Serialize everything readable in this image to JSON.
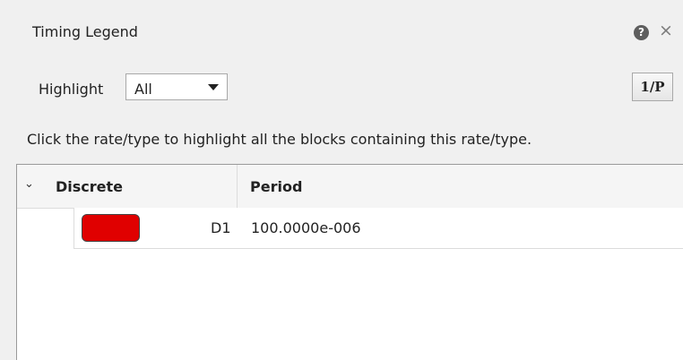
{
  "window": {
    "title": "Timing Legend",
    "help_icon": "question-circle-icon",
    "help_glyph": "?",
    "close_icon": "close-icon",
    "close_glyph": "×"
  },
  "toolbar": {
    "highlight_label": "Highlight",
    "highlight_value": "All",
    "period_button_label": "1/P"
  },
  "instructions": "Click the rate/type to highlight all the blocks containing this rate/type.",
  "table": {
    "expand_glyph": "⌄",
    "columns": [
      "Discrete",
      "Period"
    ],
    "rows": [
      {
        "color": "#e00000",
        "rate": "D1",
        "period": "100.0000e-006"
      }
    ]
  }
}
